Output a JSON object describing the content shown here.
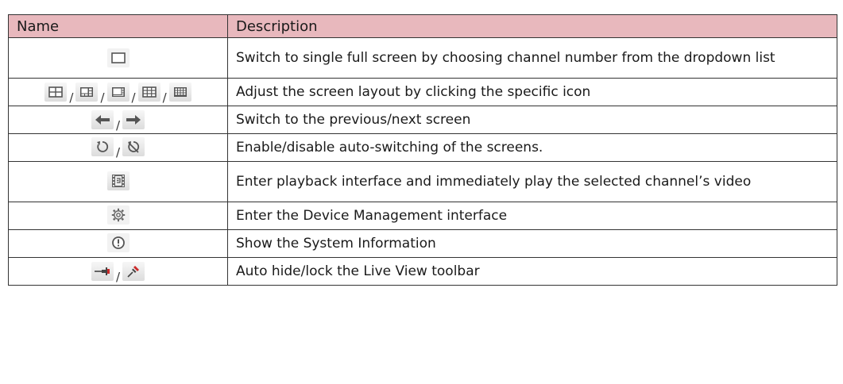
{
  "header": {
    "name": "Name",
    "description": "Description"
  },
  "rows": [
    {
      "icons": [
        "single-screen-icon"
      ],
      "description": "Switch to single full screen by choosing channel number from the dropdown list"
    },
    {
      "icons": [
        "layout-4-icon",
        "layout-6-icon",
        "layout-8-icon",
        "layout-9-icon",
        "layout-16-icon"
      ],
      "description": "Adjust the screen layout by clicking the specific icon"
    },
    {
      "icons": [
        "arrow-left-icon",
        "arrow-right-icon"
      ],
      "description": "Switch to the previous/next screen"
    },
    {
      "icons": [
        "auto-switch-icon",
        "auto-switch-off-icon"
      ],
      "description": "Enable/disable auto-switching of the screens."
    },
    {
      "icons": [
        "playback-icon"
      ],
      "description": "Enter playback interface and immediately play the selected channel’s video"
    },
    {
      "icons": [
        "gear-icon"
      ],
      "description": "Enter the Device Management interface"
    },
    {
      "icons": [
        "info-icon"
      ],
      "description": "Show the System Information"
    },
    {
      "icons": [
        "pin-unlocked-icon",
        "pin-locked-icon"
      ],
      "description": "Auto hide/lock the Live View toolbar"
    }
  ],
  "separator": "/",
  "colors": {
    "header_bg": "#e8b8bd",
    "border": "#333333",
    "icon_dark": "#555555",
    "icon_red": "#cc2a2a"
  }
}
